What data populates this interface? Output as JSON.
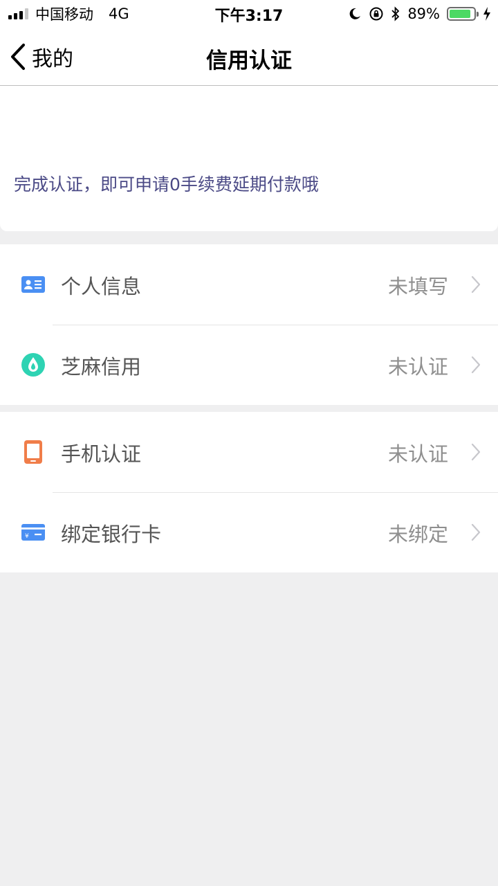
{
  "status_bar": {
    "carrier": "中国移动",
    "network": "4G",
    "time": "下午3:17",
    "battery_percent": "89%",
    "battery_level": 0.89
  },
  "nav": {
    "back_label": "我的",
    "title": "信用认证"
  },
  "banner": {
    "text": "完成认证，即可申请0手续费延期付款哦"
  },
  "groups": [
    {
      "items": [
        {
          "icon": "id-card-icon",
          "color": "#4a8ff3",
          "label": "个人信息",
          "status": "未填写"
        },
        {
          "icon": "sesame-credit-icon",
          "color": "#2ed3b3",
          "label": "芝麻信用",
          "status": "未认证"
        }
      ]
    },
    {
      "items": [
        {
          "icon": "phone-icon",
          "color": "#f07d49",
          "label": "手机认证",
          "status": "未认证"
        },
        {
          "icon": "bank-card-icon",
          "color": "#4a8ff3",
          "label": "绑定银行卡",
          "status": "未绑定"
        }
      ]
    }
  ],
  "colors": {
    "banner_text": "#4b4a86",
    "page_background": "#efeff0"
  }
}
